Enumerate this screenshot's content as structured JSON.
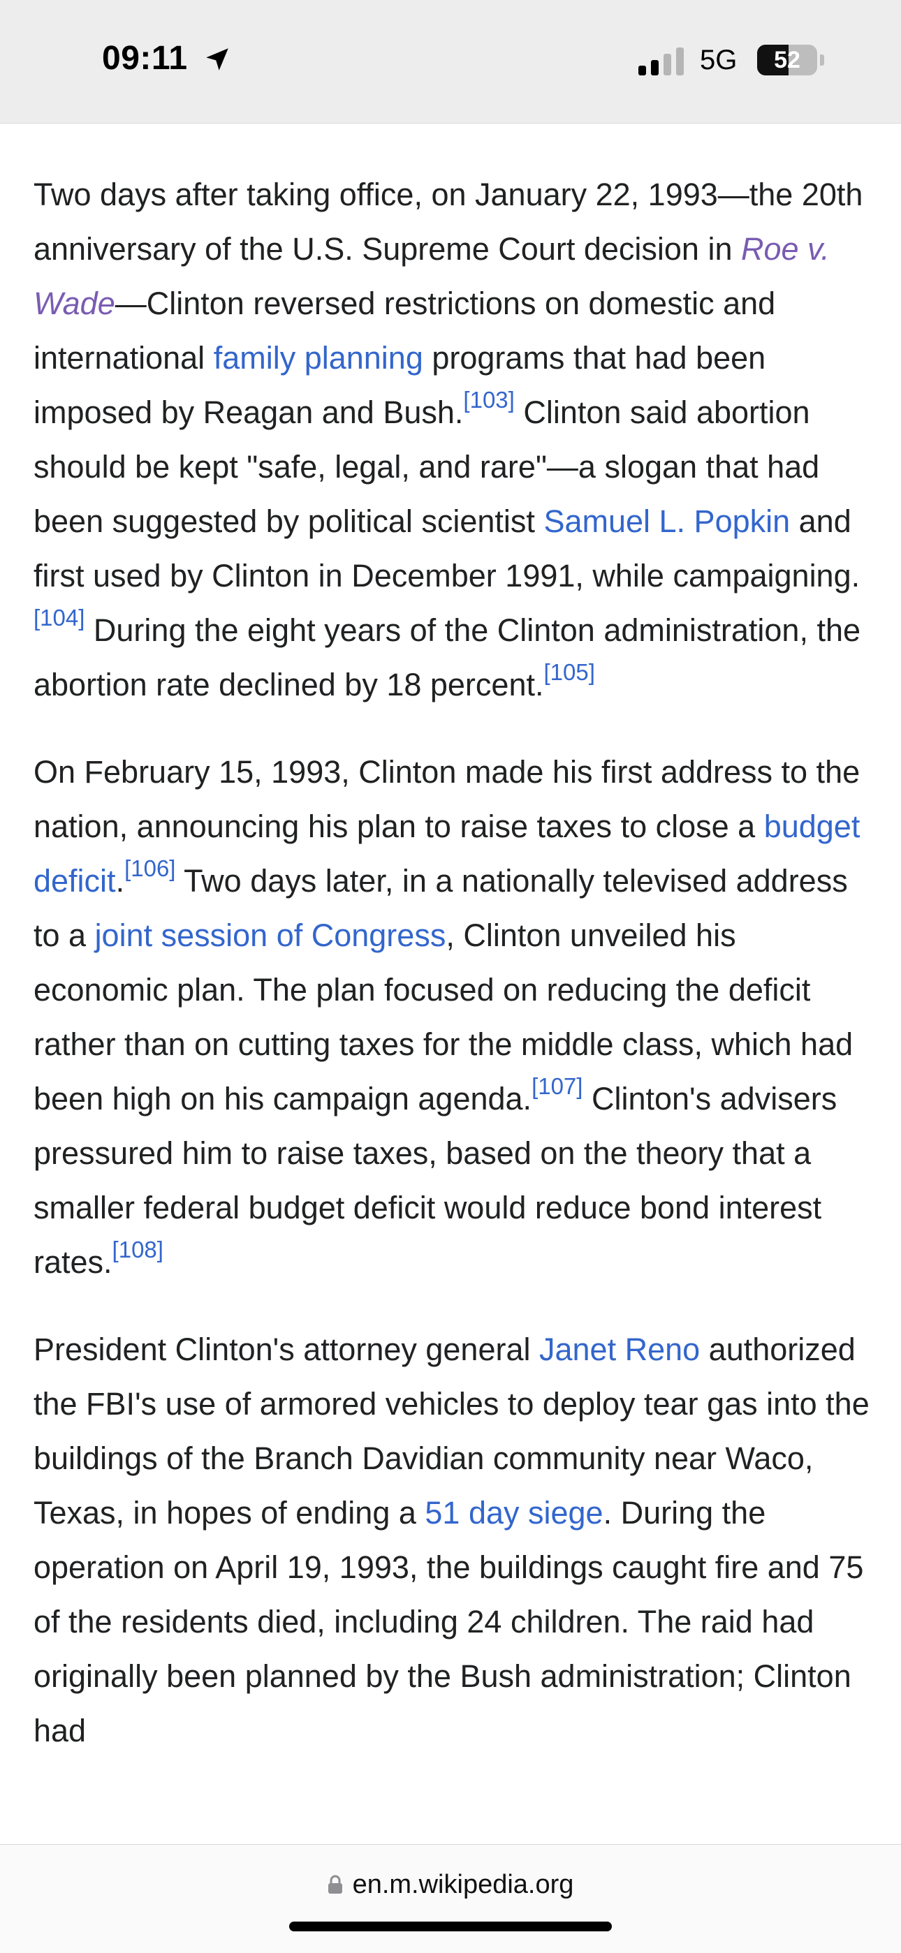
{
  "status_bar": {
    "time": "09:11",
    "network": "5G",
    "battery_level": "52",
    "battery_fraction": 0.52
  },
  "article": {
    "paragraphs": [
      {
        "parts": [
          {
            "t": "text",
            "v": "Two days after taking office, on January 22, 1993—the 20th anniversary of the U.S. Supreme Court decision in "
          },
          {
            "t": "link-visited",
            "v": "Roe v. Wade"
          },
          {
            "t": "text",
            "v": "—Clinton reversed restrictions on domestic and international "
          },
          {
            "t": "link",
            "v": "family planning"
          },
          {
            "t": "text",
            "v": " programs that had been imposed by Reagan and Bush."
          },
          {
            "t": "ref",
            "v": "[103]"
          },
          {
            "t": "text",
            "v": " Clinton said abortion should be kept \"safe, legal, and rare\"—a slogan that had been suggested by political scientist "
          },
          {
            "t": "link",
            "v": "Samuel L. Popkin"
          },
          {
            "t": "text",
            "v": " and first used by Clinton in December 1991, while campaigning."
          },
          {
            "t": "ref",
            "v": "[104]"
          },
          {
            "t": "text",
            "v": " During the eight years of the Clinton administration, the abortion rate declined by 18 percent."
          },
          {
            "t": "ref",
            "v": "[105]"
          }
        ]
      },
      {
        "parts": [
          {
            "t": "text",
            "v": "On February 15, 1993, Clinton made his first address to the nation, announcing his plan to raise taxes to close a "
          },
          {
            "t": "link",
            "v": "budget deficit"
          },
          {
            "t": "text",
            "v": "."
          },
          {
            "t": "ref",
            "v": "[106]"
          },
          {
            "t": "text",
            "v": " Two days later, in a nationally televised address to a "
          },
          {
            "t": "link",
            "v": "joint session of Congress"
          },
          {
            "t": "text",
            "v": ", Clinton unveiled his economic plan. The plan focused on reducing the deficit rather than on cutting taxes for the middle class, which had been high on his campaign agenda."
          },
          {
            "t": "ref",
            "v": "[107]"
          },
          {
            "t": "text",
            "v": " Clinton's advisers pressured him to raise taxes, based on the theory that a smaller federal budget deficit would reduce bond interest rates."
          },
          {
            "t": "ref",
            "v": "[108]"
          }
        ]
      },
      {
        "parts": [
          {
            "t": "text",
            "v": "President Clinton's attorney general "
          },
          {
            "t": "link",
            "v": "Janet Reno"
          },
          {
            "t": "text",
            "v": " authorized the FBI's use of armored vehicles to deploy tear gas into the buildings of the Branch Davidian community near Waco, Texas, in hopes of ending a "
          },
          {
            "t": "link",
            "v": "51 day siege"
          },
          {
            "t": "text",
            "v": ". During the operation on April 19, 1993, the buildings caught fire and 75 of the residents died, including 24 children. The raid had originally been planned by the Bush administration; Clinton had"
          }
        ]
      }
    ]
  },
  "browser": {
    "url": "en.m.wikipedia.org"
  }
}
